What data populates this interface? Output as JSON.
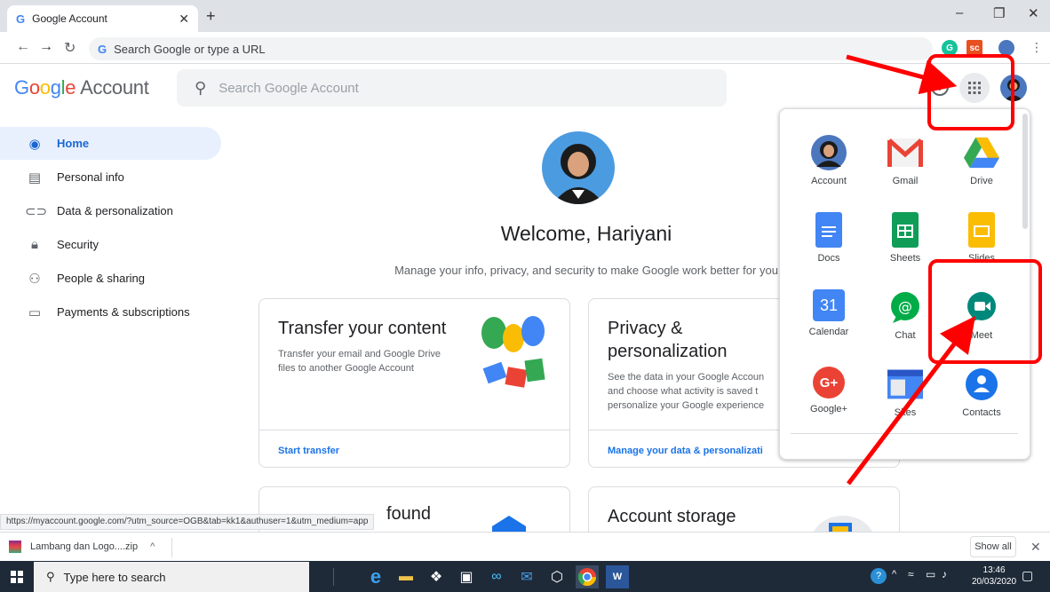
{
  "browser": {
    "tab_title": "Google Account",
    "tab_favicon": "G",
    "omnibox_placeholder": "Search Google or type a URL",
    "status_url": "https://myaccount.google.com/?utm_source=OGB&tab=kk1&authuser=1&utm_medium=app"
  },
  "header": {
    "logo_word": "Google",
    "logo_suffix": "Account",
    "search_placeholder": "Search Google Account"
  },
  "sidebar": {
    "items": [
      {
        "label": "Home",
        "icon": "account-circle-icon",
        "active": true
      },
      {
        "label": "Personal info",
        "icon": "id-card-icon"
      },
      {
        "label": "Data & personalization",
        "icon": "toggle-icon"
      },
      {
        "label": "Security",
        "icon": "lock-icon"
      },
      {
        "label": "People & sharing",
        "icon": "people-icon"
      },
      {
        "label": "Payments & subscriptions",
        "icon": "credit-card-icon"
      }
    ]
  },
  "main": {
    "welcome": "Welcome, Hariyani",
    "subtitle": "Manage your info, privacy, and security to make Google work better for you",
    "cards": [
      {
        "title": "Transfer your content",
        "desc_lines": [
          "Transfer your email and Google Drive",
          "files to another Google Account"
        ],
        "link": "Start transfer"
      },
      {
        "title_lines": [
          "Privacy &",
          "personalization"
        ],
        "desc_lines": [
          "See the data in your Google Accoun",
          "and choose what activity is saved t",
          "personalize your Google experience"
        ],
        "link": "Manage your data & personalizati"
      },
      {
        "title_fragment": "found"
      },
      {
        "title": "Account storage"
      }
    ]
  },
  "apps_menu": {
    "apps": [
      {
        "label": "Account",
        "icon": "account-avatar-icon"
      },
      {
        "label": "Gmail",
        "icon": "gmail-icon"
      },
      {
        "label": "Drive",
        "icon": "drive-icon"
      },
      {
        "label": "Docs",
        "icon": "docs-icon"
      },
      {
        "label": "Sheets",
        "icon": "sheets-icon"
      },
      {
        "label": "Slides",
        "icon": "slides-icon"
      },
      {
        "label": "Calendar",
        "icon": "calendar-icon",
        "badge": "31"
      },
      {
        "label": "Chat",
        "icon": "chat-icon"
      },
      {
        "label": "Meet",
        "icon": "meet-icon"
      },
      {
        "label": "Google+",
        "icon": "google-plus-icon",
        "badge": "G+"
      },
      {
        "label": "Sites",
        "icon": "sites-icon"
      },
      {
        "label": "Contacts",
        "icon": "contacts-icon"
      }
    ]
  },
  "downloads": {
    "file": "Lambang dan Logo....zip",
    "show_all": "Show all"
  },
  "taskbar": {
    "search_placeholder": "Type here to search",
    "time": "13:46",
    "date": "20/03/2020"
  },
  "colors": {
    "annotation_red": "#ff0000",
    "google_blue": "#1a73e8",
    "active_nav_bg": "#e8f0fe"
  }
}
